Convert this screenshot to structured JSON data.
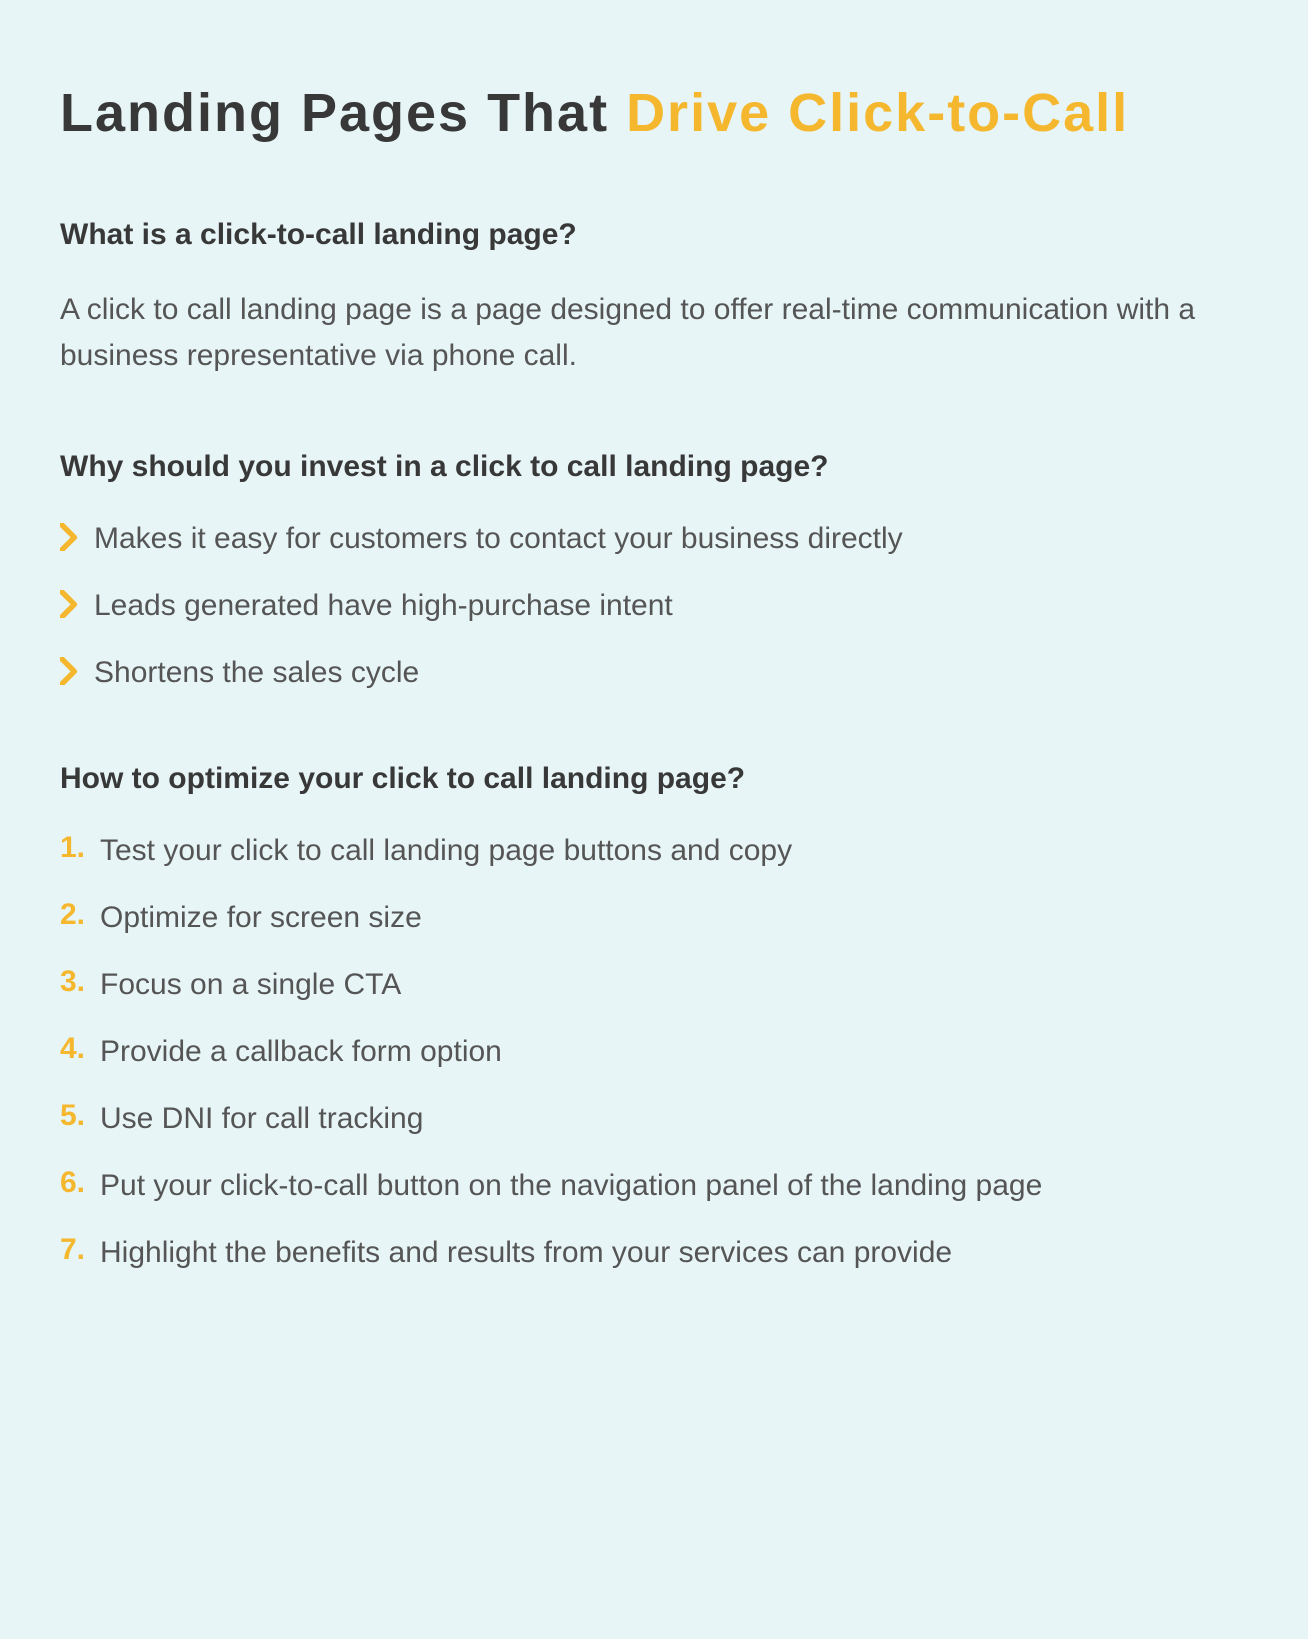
{
  "title": {
    "part1": "Landing Pages That ",
    "highlight": "Drive Click-to-Call"
  },
  "section1": {
    "heading": "What is a click-to-call landing page?",
    "body": "A click to call landing page is a page designed to offer real-time communication with a business representative via phone call."
  },
  "section2": {
    "heading": "Why should you invest in a click to call landing page?",
    "bullets": [
      "Makes it easy for customers to contact your business directly",
      "Leads generated have high-purchase intent",
      "Shortens the sales cycle"
    ]
  },
  "section3": {
    "heading": "How to optimize your click to call landing page?",
    "items": [
      {
        "num": "1.",
        "text": "Test your click to call landing page buttons and copy"
      },
      {
        "num": "2.",
        "text": "Optimize for screen size"
      },
      {
        "num": "3.",
        "text": "Focus on a single CTA"
      },
      {
        "num": "4.",
        "text": "Provide a callback form option"
      },
      {
        "num": "5.",
        "text": "Use DNI for call tracking"
      },
      {
        "num": "6.",
        "text": "Put your click-to-call button on the navigation panel of the landing page"
      },
      {
        "num": "7.",
        "text": "Highlight the benefits and results from your services can provide"
      }
    ]
  },
  "colors": {
    "background": "#e7f5f7",
    "accent": "#f4b72e",
    "textDark": "#383838",
    "textBody": "#555555"
  }
}
